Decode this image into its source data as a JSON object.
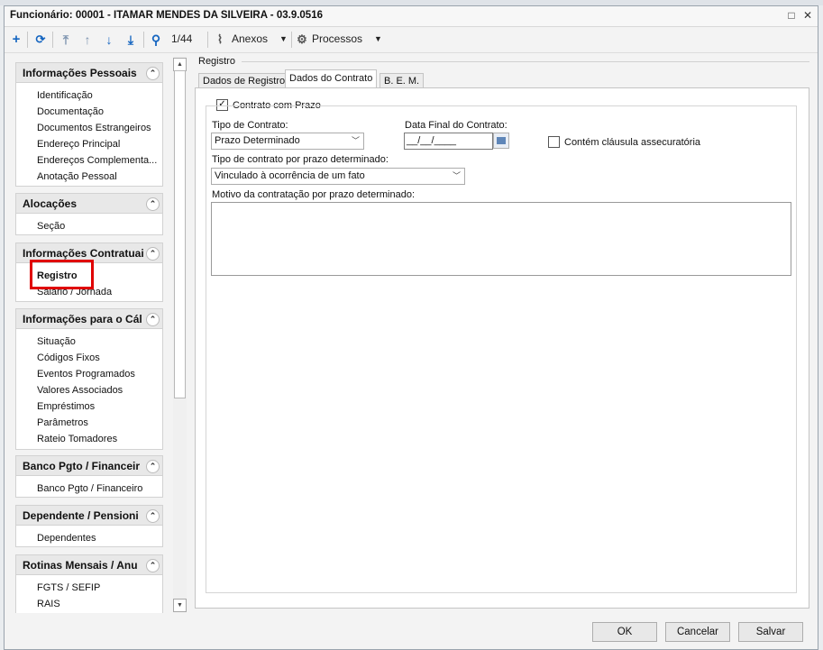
{
  "window": {
    "title": "Funcionário: 00001 - ITAMAR MENDES DA SILVEIRA - 03.9.0516"
  },
  "toolbar": {
    "record_counter": "1/44",
    "anexos_label": "Anexos",
    "processos_label": "Processos"
  },
  "nav": {
    "sections": [
      {
        "title": "Informações Pessoais",
        "items": [
          "Identificação",
          "Documentação",
          "Documentos Estrangeiros",
          "Endereço Principal",
          "Endereços Complementa...",
          "Anotação Pessoal"
        ]
      },
      {
        "title": "Alocações",
        "items": [
          "Seção"
        ]
      },
      {
        "title": "Informações Contratuai",
        "items": [
          "Registro",
          "Salário / Jornada"
        ]
      },
      {
        "title": "Informações para o Cál",
        "items": [
          "Situação",
          "Códigos Fixos",
          "Eventos Programados",
          "Valores Associados",
          "Empréstimos",
          "Parâmetros",
          "Rateio Tomadores"
        ]
      },
      {
        "title": "Banco Pgto / Financeir",
        "items": [
          "Banco Pgto / Financeiro"
        ]
      },
      {
        "title": "Dependente / Pensioni",
        "items": [
          "Dependentes"
        ]
      },
      {
        "title": "Rotinas Mensais / Anu",
        "items": [
          "FGTS / SEFIP",
          "RAIS"
        ]
      }
    ],
    "selected_item": "Registro"
  },
  "panel": {
    "group_label": "Registro",
    "tabs": [
      "Dados de Registro",
      "Dados do Contrato",
      "B. E. M."
    ],
    "active_tab": "Dados do Contrato",
    "contrato_com_prazo": {
      "label": "Contrato com Prazo",
      "checked": true
    },
    "tipo_contrato": {
      "label": "Tipo de Contrato:",
      "value": "Prazo Determinado"
    },
    "data_final": {
      "label": "Data Final do Contrato:",
      "value": "__/__/____"
    },
    "clausula": {
      "label": "Contém cláusula assecuratória",
      "checked": false
    },
    "tipo_prazo": {
      "label": "Tipo de contrato por prazo determinado:",
      "value": "Vinculado à ocorrência de um fato"
    },
    "motivo": {
      "label": "Motivo da contratação por prazo determinado:",
      "value": ""
    }
  },
  "footer": {
    "ok_label": "OK",
    "cancel_label": "Cancelar",
    "save_label": "Salvar"
  },
  "colors": {
    "accent": "#1565c0",
    "highlight": "#e00000"
  }
}
